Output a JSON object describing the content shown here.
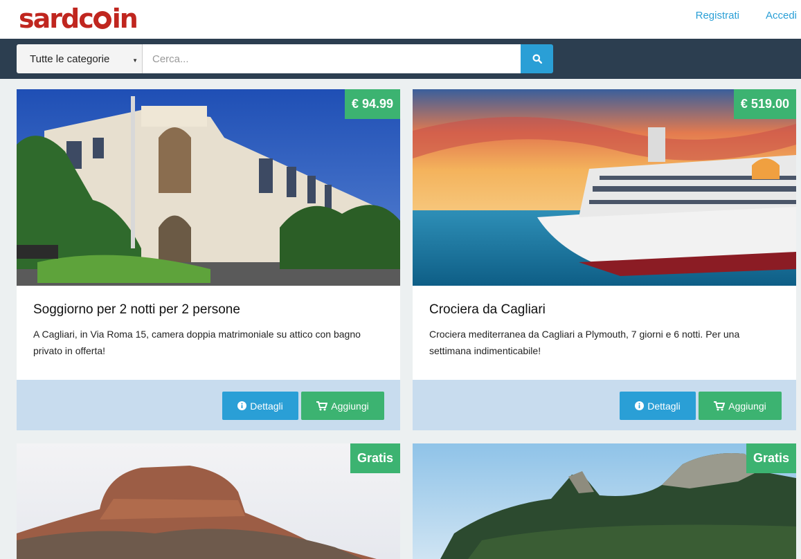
{
  "header": {
    "logo": "sardcoin",
    "register": "Registrati",
    "login": "Accedi"
  },
  "search": {
    "category": "Tutte le categorie",
    "placeholder": "Cerca..."
  },
  "cards": [
    {
      "price": "€ 94.99",
      "title": "Soggiorno per 2 notti per 2 persone",
      "description": "A Cagliari, in Via Roma 15, camera doppia matrimoniale su attico con bagno privato in offerta!",
      "details_label": "Dettagli",
      "add_label": "Aggiungi"
    },
    {
      "price": "€ 519.00",
      "title": "Crociera da Cagliari",
      "description": "Crociera mediterranea da Cagliari a Plymouth, 7 giorni e 6 notti. Per una settimana indimenticabile!",
      "details_label": "Dettagli",
      "add_label": "Aggiungi"
    },
    {
      "price": "Gratis"
    },
    {
      "price": "Gratis"
    }
  ],
  "colors": {
    "brand": "#c0261f",
    "accent": "#2a9fd6",
    "success": "#3cb371",
    "navbar": "#2c3e50"
  }
}
